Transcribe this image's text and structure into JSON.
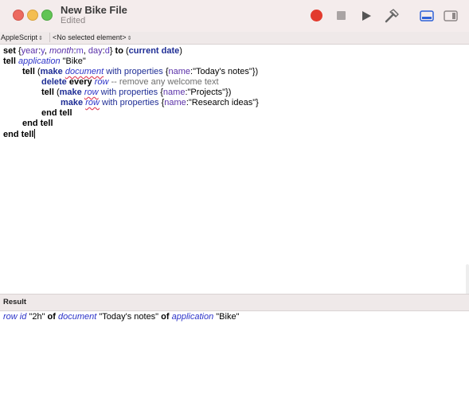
{
  "window": {
    "title": "New Bike File",
    "subtitle": "Edited"
  },
  "toolbar": {
    "record_icon": "record-icon",
    "stop_icon": "stop-icon",
    "run_icon": "run-icon",
    "compile_icon": "hammer-icon",
    "view_bottom_icon": "bottom-panel-icon",
    "view_side_icon": "side-panel-icon",
    "record_color": "#e23a2d",
    "view_active_color": "#2f62d8"
  },
  "navbar": {
    "language": "AppleScript",
    "element": "<No selected element>"
  },
  "code": {
    "l1": {
      "set": "set",
      "brace_open": "{",
      "year_key": "year",
      "colon1": ":",
      "year_var": "y",
      "comma1": ", ",
      "month_key": "month",
      "colon2": ":",
      "month_var": "m",
      "comma2": ", ",
      "day_key": "day",
      "colon3": ":",
      "day_var": "d",
      "brace_close": "} ",
      "to": "to",
      "paren_open": " (",
      "current_date": "current date",
      "paren_close": ")"
    },
    "l2": {
      "tell": "tell",
      "application": "application",
      "name": "\"Bike\""
    },
    "l3": {
      "tell": "tell",
      "paren": " (",
      "make": "make",
      "document": "document",
      "with_properties": "with properties",
      "brace": " {",
      "name_key": "name",
      "colon": ":",
      "name_val": "\"Today's notes\"",
      "close": "})"
    },
    "l4": {
      "delete": "delete",
      "every": "every",
      "row": "row",
      "comment": "-- remove any welcome text"
    },
    "l5": {
      "tell": "tell",
      "paren": " (",
      "make": "make",
      "row": "row",
      "with_properties": "with properties",
      "brace": " {",
      "name_key": "name",
      "colon": ":",
      "name_val": "\"Projects\"",
      "close": "})"
    },
    "l6": {
      "make": "make",
      "row": "row",
      "with_properties": "with properties",
      "brace": " {",
      "name_key": "name",
      "colon": ":",
      "name_val": "\"Research ideas\"",
      "close": "}"
    },
    "l7": {
      "end_tell": "end tell"
    },
    "l8": {
      "end_tell": "end tell"
    },
    "l9": {
      "end_tell": "end tell"
    }
  },
  "result": {
    "header": "Result",
    "row": "row",
    "id": "id",
    "id_val": "\"2h\"",
    "of1": "of",
    "document": "document",
    "doc_val": "\"Today's notes\"",
    "of2": "of",
    "application": "application",
    "app_val": "\"Bike\""
  }
}
